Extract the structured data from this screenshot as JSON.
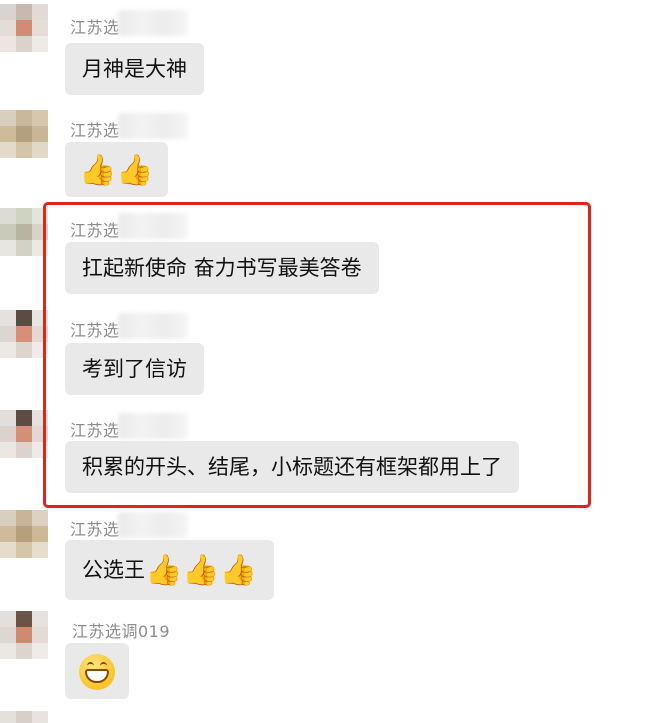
{
  "messages": [
    {
      "sender": "江苏选",
      "text": "月神是大神",
      "kind": "text"
    },
    {
      "sender": "江苏选",
      "text": "👍👍",
      "kind": "emoji"
    },
    {
      "sender": "江苏选",
      "text": "扛起新使命 奋力书写最美答卷",
      "kind": "text"
    },
    {
      "sender": "江苏选",
      "text": "考到了信访",
      "kind": "text"
    },
    {
      "sender": "江苏选",
      "text": "积累的开头、结尾，小标题还有框架都用上了",
      "kind": "text"
    },
    {
      "sender": "江苏选",
      "text": "公选王",
      "kind": "text",
      "suffix": "👍👍👍"
    },
    {
      "sender": "江苏选调019",
      "text": "",
      "kind": "grin-emoji"
    }
  ],
  "highlight_color": "#e2231a",
  "bubble_color": "#e9e9e9",
  "sender_color": "#8c8c8c"
}
